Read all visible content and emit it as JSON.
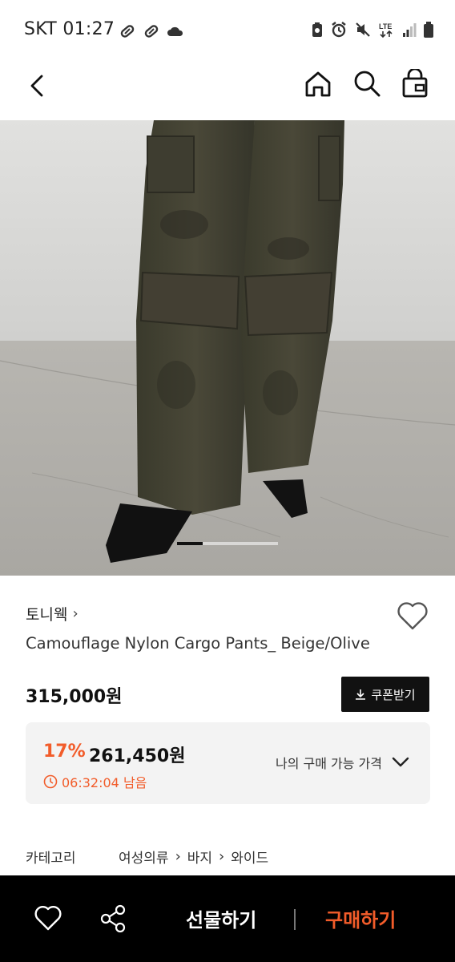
{
  "status_bar": {
    "carrier_time": "SKT 01:27",
    "network": "LTE"
  },
  "nav": {
    "back_icon": "chevron-left-icon",
    "home_icon": "home-icon",
    "search_icon": "search-icon",
    "bag_icon": "shopping-bag-icon"
  },
  "product": {
    "image_description_icon": "product-photo",
    "carousel": {
      "current_fraction": 0.25
    },
    "brand": "토니웩",
    "brand_chevron": "›",
    "title": "Camouflage Nylon Cargo Pants_ Beige/Olive",
    "price": "315,000원",
    "coupon_label": "쿠폰받기"
  },
  "discount": {
    "rate": "17%",
    "price": "261,450원",
    "timer": "06:32:04 남음",
    "my_price_label": "나의 구매 가능 가격"
  },
  "category": {
    "label": "카테고리",
    "crumbs": [
      "여성의류",
      "바지",
      "와이드"
    ]
  },
  "bottom_bar": {
    "gift_label": "선물하기",
    "buy_label": "구매하기"
  },
  "colors": {
    "accent": "#f25c2a",
    "dark": "#111111",
    "panel": "#f3f3f3"
  }
}
